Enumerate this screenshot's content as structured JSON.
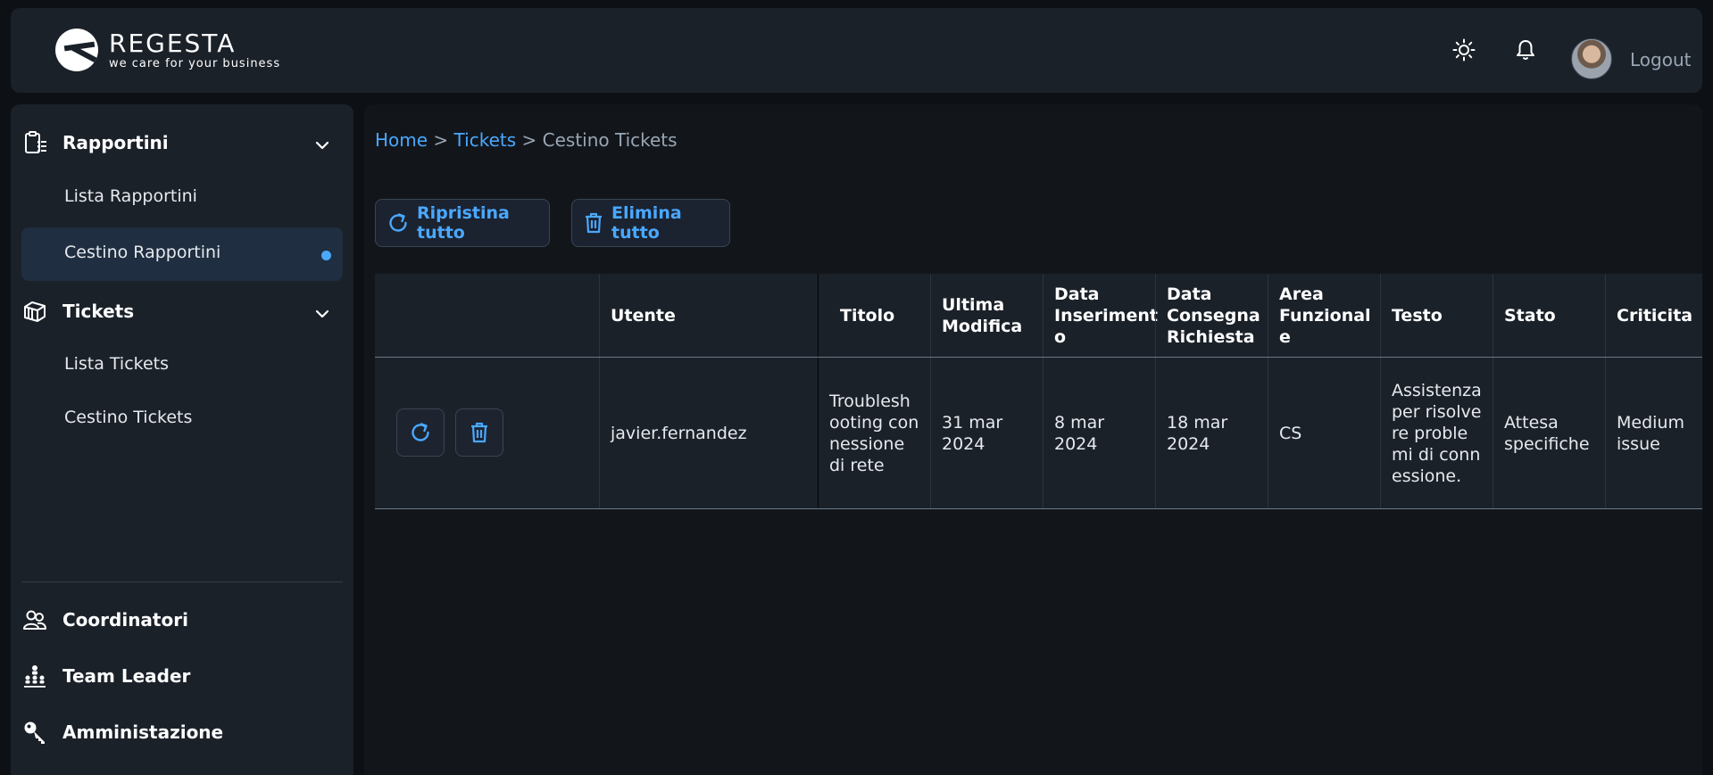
{
  "header": {
    "brand_name": "REGESTA",
    "brand_tagline": "we care for your business",
    "logout_label": "Logout",
    "icons": [
      "sun-icon",
      "bell-icon",
      "avatar"
    ]
  },
  "sidebar": {
    "groups": [
      {
        "label": "Rapportini",
        "icon": "clipboard-list-icon",
        "items": [
          "Lista Rapportini",
          "Cestino Rapportini"
        ]
      },
      {
        "label": "Tickets",
        "icon": "ticket-icon",
        "items": [
          "Lista Tickets",
          "Cestino Tickets"
        ]
      }
    ],
    "bottom": [
      {
        "label": "Coordinatori",
        "icon": "users-icon"
      },
      {
        "label": "Team Leader",
        "icon": "hierarchy-icon"
      },
      {
        "label": "Amministazione",
        "icon": "key-icon"
      }
    ],
    "active_item": "Cestino Rapportini"
  },
  "breadcrumb": {
    "home": "Home",
    "sep1": " > ",
    "tickets": "Tickets",
    "sep2": " > ",
    "current": "Cestino Tickets"
  },
  "actions": {
    "restore_all": "Ripristina tutto",
    "delete_all": "Elimina tutto"
  },
  "table": {
    "headers": [
      "Utente",
      "Titolo",
      "Ultima Modifica",
      "Data Inseriment o",
      "Data Consegna Richiesta",
      "Area Funzional e",
      "Testo",
      "Stato",
      "Criticita"
    ],
    "rows": [
      {
        "utente": "javier.fernandez",
        "titolo": "Troubleshooting connessione di rete",
        "ultima_modifica": "31 mar 2024",
        "data_inserimento": "8 mar 2024",
        "data_consegna": "18 mar 2024",
        "area": "CS",
        "testo": "Assistenza per risolvere problemi di connessione.",
        "stato": "Attesa specifiche",
        "criticita": "Medium issue"
      }
    ]
  },
  "colors": {
    "accent": "#4aa8ff",
    "panel": "#1b2129",
    "background": "#0d1014"
  }
}
